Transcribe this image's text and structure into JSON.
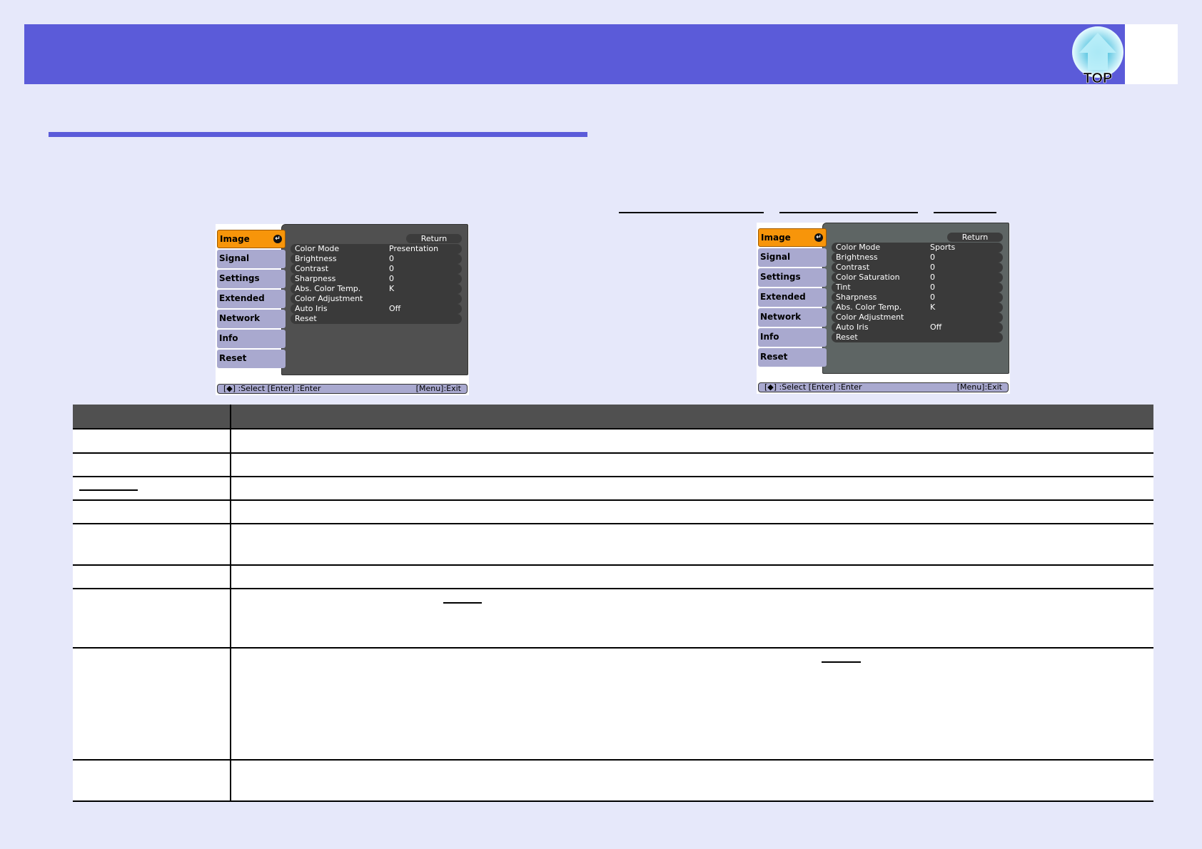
{
  "header": {
    "top_label": "TOP"
  },
  "menu_presentation": {
    "side": [
      "Image",
      "Signal",
      "Settings",
      "Extended",
      "Network",
      "Info",
      "Reset"
    ],
    "return": "Return",
    "items": [
      [
        "Color Mode",
        "Presentation"
      ],
      [
        "Brightness",
        "0"
      ],
      [
        "Contrast",
        "0"
      ],
      [
        "Sharpness",
        "0"
      ],
      [
        "Abs. Color Temp.",
        "K"
      ],
      [
        "Color Adjustment",
        ""
      ],
      [
        "Auto Iris",
        "Off"
      ],
      [
        "Reset",
        ""
      ]
    ],
    "footer_left": "[◆] :Select  [Enter] :Enter",
    "footer_right": "[Menu]:Exit"
  },
  "menu_sports": {
    "side": [
      "Image",
      "Signal",
      "Settings",
      "Extended",
      "Network",
      "Info",
      "Reset"
    ],
    "return": "Return",
    "items": [
      [
        "Color Mode",
        "Sports"
      ],
      [
        "Brightness",
        "0"
      ],
      [
        "Contrast",
        "0"
      ],
      [
        "Color Saturation",
        "0"
      ],
      [
        "Tint",
        "0"
      ],
      [
        "Sharpness",
        "0"
      ],
      [
        "Abs. Color Temp.",
        "K"
      ],
      [
        "Color Adjustment",
        ""
      ],
      [
        "Auto Iris",
        "Off"
      ],
      [
        "Reset",
        ""
      ]
    ],
    "footer_left": "[◆] :Select  [Enter] :Enter",
    "footer_right": "[Menu]:Exit"
  },
  "colors": {
    "accent": "#5b5bd9",
    "bg": "#e6e8fa"
  }
}
